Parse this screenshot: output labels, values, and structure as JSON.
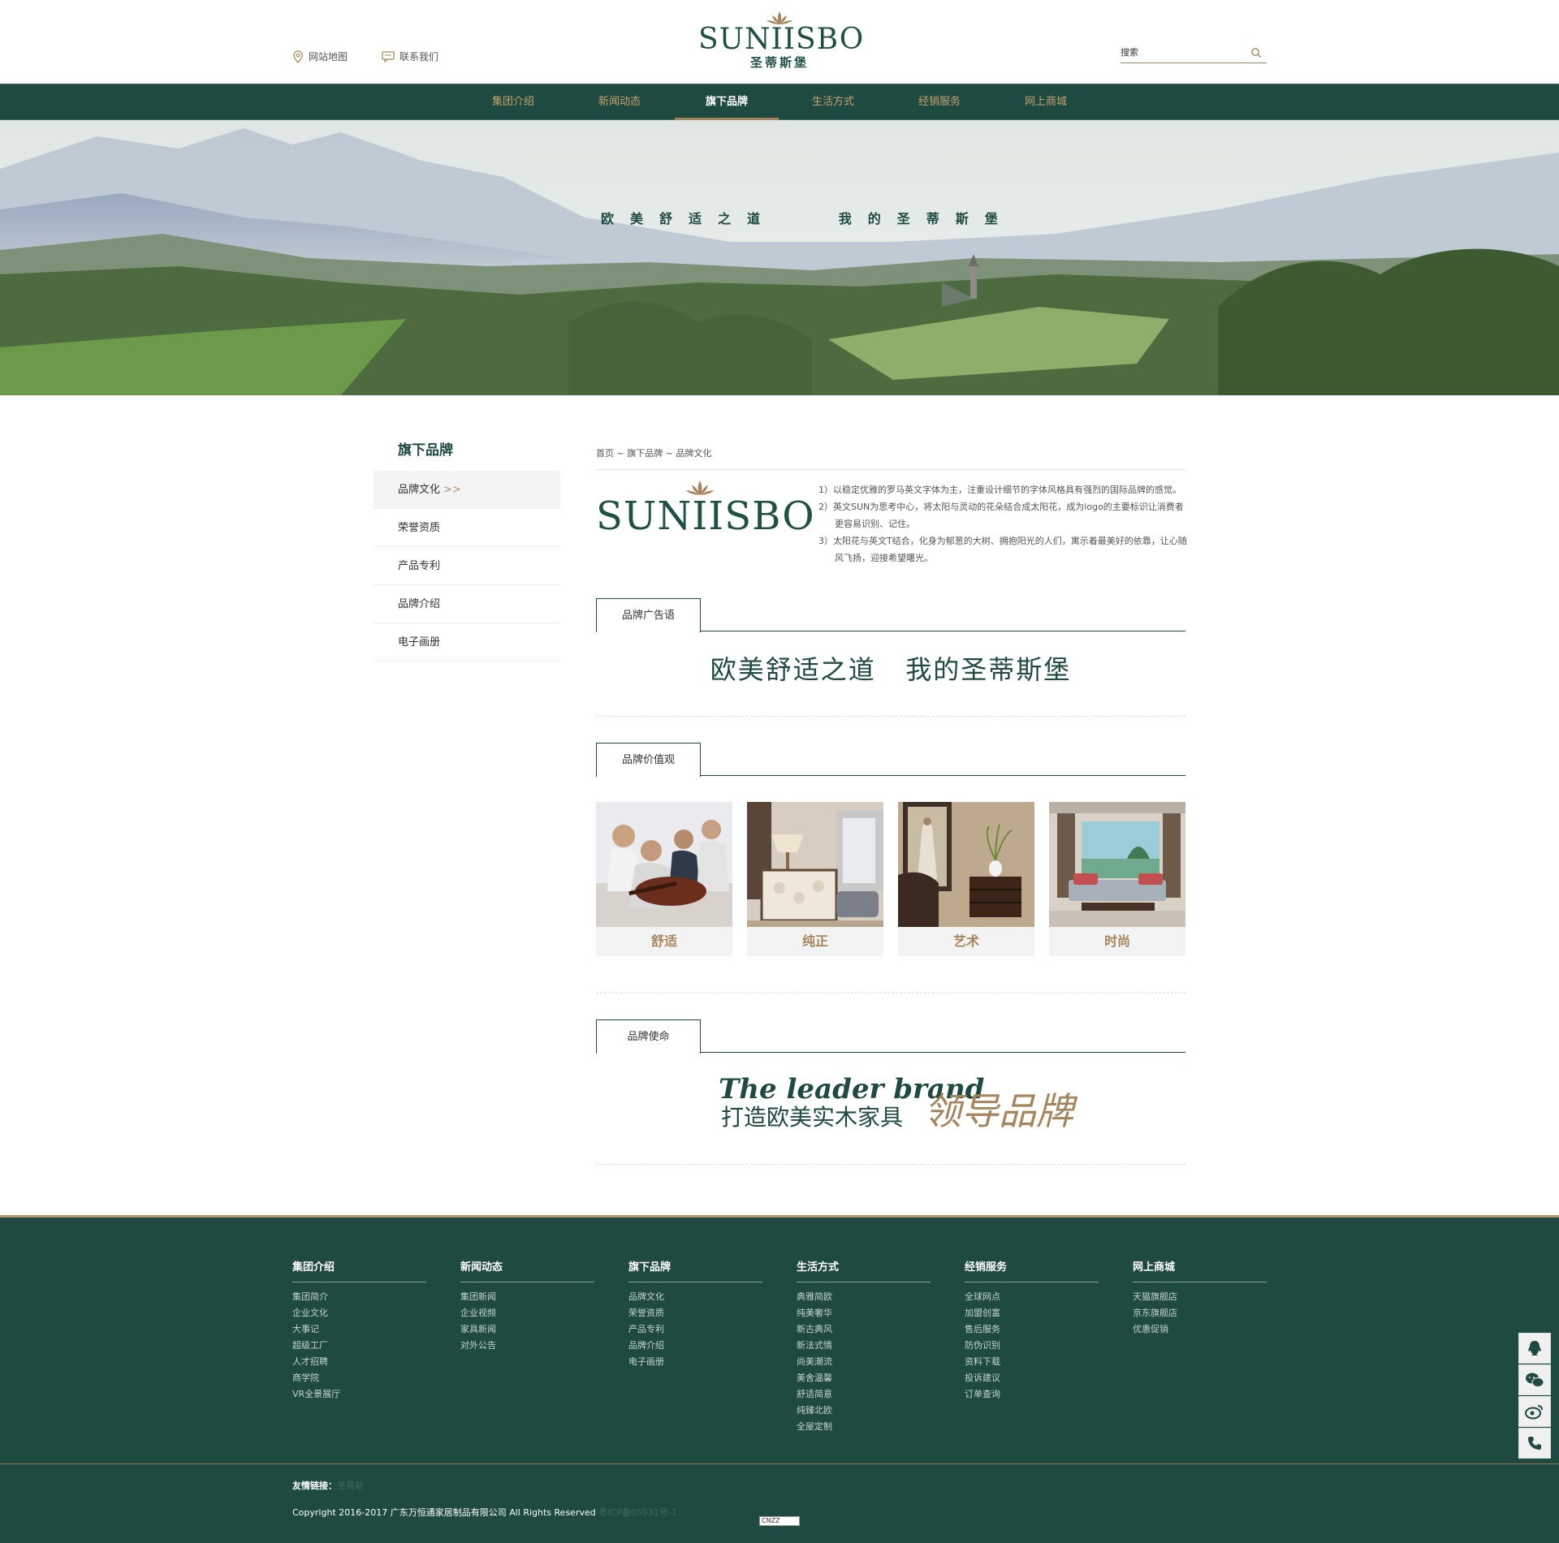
{
  "header": {
    "sitemap_label": "网站地图",
    "contact_label": "联系我们",
    "logo_text": "SUNIISBO",
    "logo_sub": "圣蒂斯堡",
    "search_placeholder": "搜索"
  },
  "nav": {
    "items": [
      "集团介绍",
      "新闻动态",
      "旗下品牌",
      "生活方式",
      "经销服务",
      "网上商城"
    ],
    "active": "旗下品牌"
  },
  "banner": {
    "slogan": "欧美舒适之道   我的圣蒂斯堡"
  },
  "sidebar": {
    "title": "旗下品牌",
    "items": [
      "品牌文化",
      "荣誉资质",
      "产品专利",
      "品牌介绍",
      "电子画册"
    ],
    "active_arrow": ">>"
  },
  "breadcrumb": {
    "text": "首页 ~ 旗下品牌 ~ 品牌文化"
  },
  "intro": {
    "logo_text": "SUNIISBO",
    "lines": [
      "1）以稳定优雅的罗马英文字体为主，注重设计细节的字体风格具有强烈的国际品牌的感觉。",
      "2）英文SUN为思考中心，将太阳与灵动的花朵结合成太阳花，成为logo的主要标识让消费者更容易识别、记住。",
      "3）太阳花与英文T结合，化身为郁葱的大树、拥抱阳光的人们，寓示着最美好的依靠，让心随风飞扬，迎接希望曙光。"
    ]
  },
  "sections": {
    "ad": {
      "tab": "品牌广告语",
      "slogan": "欧美舒适之道   我的圣蒂斯堡"
    },
    "values": {
      "tab": "品牌价值观",
      "cards": [
        {
          "caption": "舒适",
          "icon": "friends-guitar-photo"
        },
        {
          "caption": "纯正",
          "icon": "lamp-cabinet-photo"
        },
        {
          "caption": "艺术",
          "icon": "painting-chest-photo"
        },
        {
          "caption": "时尚",
          "icon": "living-room-photo"
        }
      ]
    },
    "mission": {
      "tab": "品牌使命",
      "en": "The leader brand",
      "cn": "打造欧美实木家具",
      "gold": "领导品牌"
    }
  },
  "footer": {
    "columns": [
      {
        "head": "集团介绍",
        "links": [
          "集团简介",
          "企业文化",
          "大事记",
          "超级工厂",
          "人才招聘",
          "商学院",
          "VR全景展厅"
        ]
      },
      {
        "head": "新闻动态",
        "links": [
          "集团新闻",
          "企业视频",
          "家具新闻",
          "对外公告"
        ]
      },
      {
        "head": "旗下品牌",
        "links": [
          "品牌文化",
          "荣誉资质",
          "产品专利",
          "品牌介绍",
          "电子画册"
        ]
      },
      {
        "head": "生活方式",
        "links": [
          "典雅简欧",
          "纯美奢华",
          "新古典风",
          "新法式情",
          "尚美潮流",
          "美舍温馨",
          "舒适简意",
          "纯臻北欧",
          "全屋定制"
        ]
      },
      {
        "head": "经销服务",
        "links": [
          "全球网点",
          "加盟创富",
          "售后服务",
          "防伪识别",
          "资料下载",
          "投诉建议",
          "订单查询"
        ]
      },
      {
        "head": "网上商城",
        "links": [
          "天猫旗舰店",
          "京东旗舰店",
          "优惠促销"
        ]
      }
    ],
    "friend_label": "友情链接：",
    "friend_link": "圣蒂斯",
    "copyright": "Copyright  2016-2017  广东万恒通家居制品有限公司 All Rights Reserved",
    "icp": "粤ICP备05031号-1",
    "cnzz": "CNZZ"
  },
  "floatbar": [
    "qq-icon",
    "wechat-icon",
    "weibo-icon",
    "phone-icon"
  ],
  "colors": {
    "brand_green": "#1e4a41",
    "gold": "#a5855b"
  }
}
